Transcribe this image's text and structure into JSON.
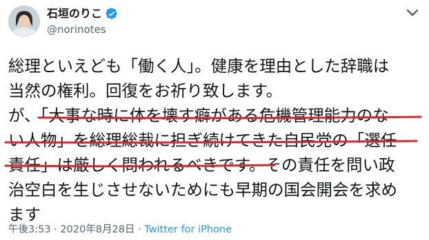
{
  "author": {
    "display_name": "石垣のりこ",
    "handle": "@norinotes"
  },
  "tweet": {
    "lines": [
      "総理といえども「働く人」。健康を理由とした辞職は",
      "当然の権利。回復をお祈り致します。",
      "が、「大事な時に体を壊す癖がある危機管理能力のな",
      "い人物」を総理総裁に担ぎ続けてきた自民党の「選任",
      "責任」は厳しく問われるべきです。その責任を問い政",
      "治空白を生じさせないためにも早期の国会開会を求め",
      "ます"
    ]
  },
  "meta": {
    "time": "午後3:53",
    "sep": " · ",
    "date": "2020年8月28日",
    "source": "Twitter for iPhone"
  },
  "colors": {
    "underline": "#d9262b",
    "verified": "#1d9bf0",
    "link": "#1d9bf0"
  },
  "icons": {
    "verified": "verified-badge-icon",
    "caret": "chevron-down-icon"
  }
}
